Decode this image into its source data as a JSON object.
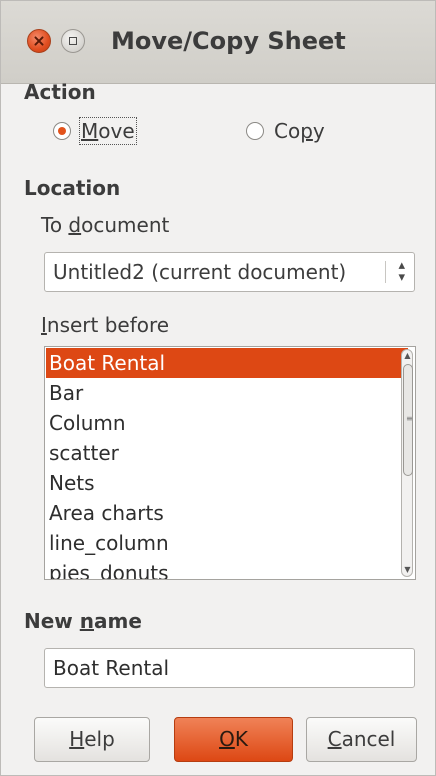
{
  "window": {
    "title": "Move/Copy Sheet",
    "close_icon": "close-icon",
    "maximize_icon": "maximize-icon"
  },
  "action": {
    "label": "Action",
    "options": [
      {
        "label_underlined": "M",
        "label_rest": "ove",
        "checked": true
      },
      {
        "label_pre": "Co",
        "label_underlined": "p",
        "label_rest": "y",
        "checked": false
      }
    ]
  },
  "location": {
    "label": "Location",
    "to_document_pre": "To ",
    "to_document_underlined": "d",
    "to_document_rest": "ocument",
    "document_value": "Untitled2 (current document)",
    "insert_before_underlined": "I",
    "insert_before_rest": "nsert before",
    "sheets": [
      "Boat Rental",
      "Bar",
      "Column",
      "scatter",
      "Nets",
      "Area charts",
      "line_column",
      "pies_donuts"
    ],
    "selected_index": 0
  },
  "new_name": {
    "label_pre": "New ",
    "label_underlined": "n",
    "label_rest": "ame",
    "value": "Boat Rental"
  },
  "buttons": {
    "help_underlined": "H",
    "help_rest": "elp",
    "ok_underlined": "O",
    "ok_rest": "K",
    "cancel_underlined": "C",
    "cancel_rest": "ancel"
  },
  "colors": {
    "accent": "#dd4814",
    "background": "#f2f1f0"
  }
}
